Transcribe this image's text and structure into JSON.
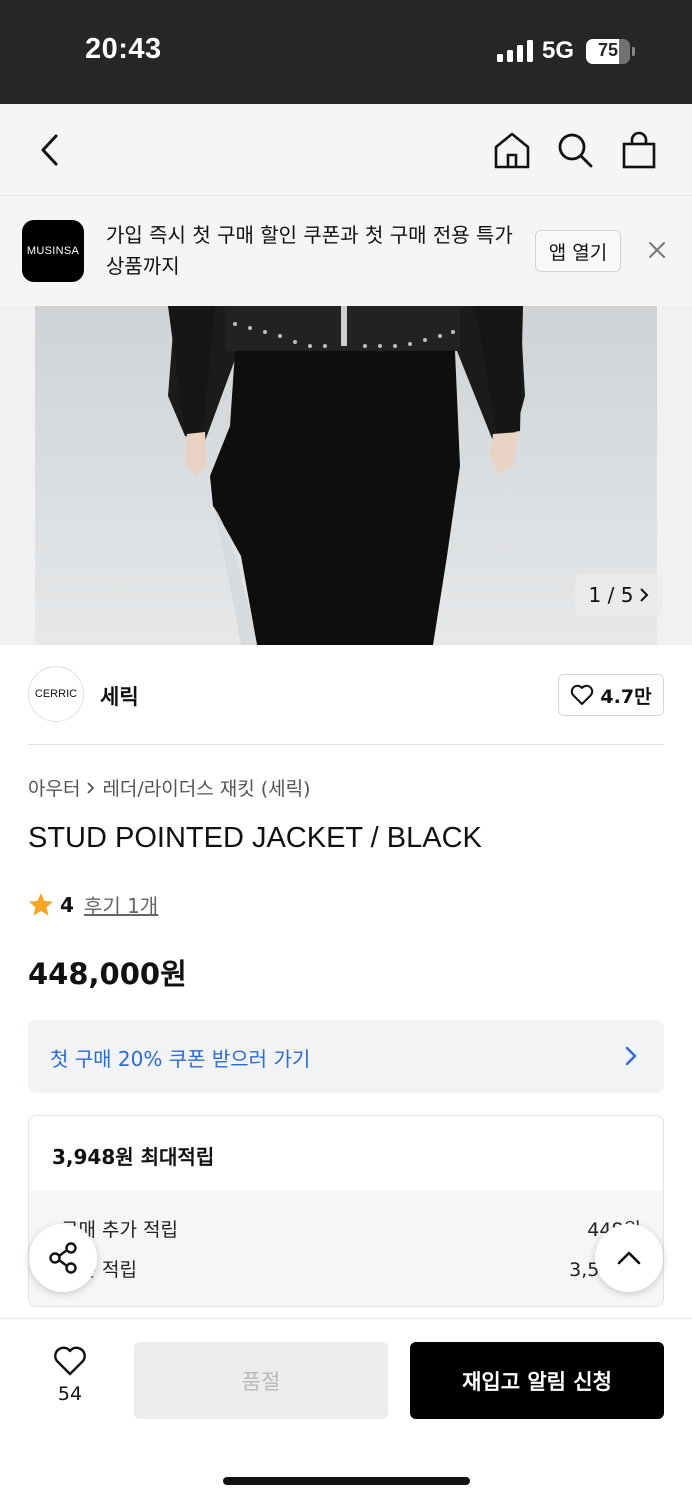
{
  "status_bar": {
    "time": "20:43",
    "network": "5G",
    "battery": "75",
    "battery_level": 0.75
  },
  "nav": {
    "back_icon": "chevron-left-icon",
    "home_icon": "home-icon",
    "search_icon": "search-icon",
    "cart_icon": "shopping-bag-icon"
  },
  "app_banner": {
    "logo": "MUSINSA",
    "message": "가입 즉시 첫 구매 할인 쿠폰과 첫 구매 전용 특가 상품까지",
    "open_label": "앱 열기",
    "close_icon": "close-icon"
  },
  "gallery": {
    "counter": "1 / 5"
  },
  "brand": {
    "logo": "CERRIC",
    "name": "세릭",
    "likes": "4.7만"
  },
  "breadcrumb": {
    "category": "아우터",
    "subcategory": "레더/라이더스 재킷 (세릭)"
  },
  "product": {
    "title": "STUD POINTED JACKET / BLACK",
    "rating": "4",
    "reviews": "후기 1개",
    "price": "448,000원"
  },
  "coupon": {
    "label": "첫 구매 20% 쿠폰 받으러 가기"
  },
  "points": {
    "title": "3,948원 최대적립",
    "lines": [
      {
        "label": "구매 추가 적립",
        "value": "448원"
      },
      {
        "label": "기본 적립",
        "value": "3,500원"
      }
    ]
  },
  "bottom": {
    "wish_count": "54",
    "soldout_label": "품절",
    "restock_label": "재입고 알림 신청"
  },
  "colors": {
    "accent_blue": "#2c6bd6",
    "star": "#f5a623",
    "primary": "#000000"
  }
}
